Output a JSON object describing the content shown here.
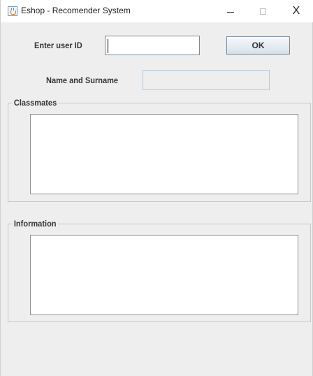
{
  "window": {
    "title": "Eshop - Recomender System",
    "controls": {
      "minimize": "—",
      "maximize": "□",
      "close": "X"
    }
  },
  "form": {
    "user_id_label": "Enter user ID",
    "user_id_value": "",
    "ok_label": "OK",
    "name_label": "Name and Surname",
    "name_value": ""
  },
  "panels": {
    "classmates": {
      "title": "Classmates",
      "content": ""
    },
    "information": {
      "title": "Information",
      "content": ""
    }
  },
  "icons": {
    "app": "java-cup-icon",
    "minimize": "minimize-icon",
    "maximize": "maximize-icon",
    "close": "close-icon"
  }
}
